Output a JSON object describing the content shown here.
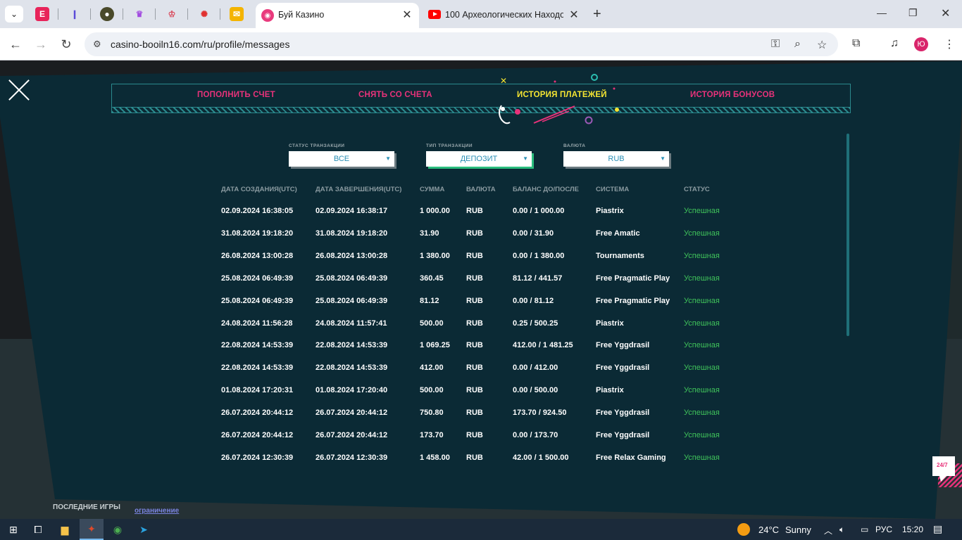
{
  "browser": {
    "tabs": [
      {
        "title": "Буй Казино",
        "active": true
      },
      {
        "title": "100 Археологических Находок",
        "active": false
      }
    ],
    "url": "casino-booiln16.com/ru/profile/messages",
    "profile_initial": "Ю"
  },
  "nav_tabs": {
    "deposit": "ПОПОЛНИТЬ СЧЕТ",
    "withdraw": "СНЯТЬ СО СЧЕТА",
    "payment_history": "ИСТОРИЯ ПЛАТЕЖЕЙ",
    "bonus_history": "ИСТОРИЯ БОНУСОВ"
  },
  "colors": {
    "tab_inactive": "#e8327a",
    "tab_active": "#f5e532",
    "status_success": "#3fc25a",
    "modal_bg": "#0b2a35"
  },
  "filters": {
    "status": {
      "label": "СТАТУС ТРАНЗАКЦИИ",
      "value": "ВСЕ"
    },
    "type": {
      "label": "ТИП ТРАНЗАКЦИИ",
      "value": "ДЕПОЗИТ"
    },
    "currency": {
      "label": "ВАЛЮТА",
      "value": "RUB"
    }
  },
  "table": {
    "headers": [
      "ДАТА СОЗДАНИЯ(UTC)",
      "ДАТА ЗАВЕРШЕНИЯ(UTC)",
      "СУММА",
      "ВАЛЮТА",
      "БАЛАНС ДО/ПОСЛЕ",
      "СИСТЕМА",
      "СТАТУС"
    ],
    "rows": [
      [
        "02.09.2024 16:38:05",
        "02.09.2024 16:38:17",
        "1 000.00",
        "RUB",
        "0.00 / 1 000.00",
        "Piastrix",
        "Успешная"
      ],
      [
        "31.08.2024 19:18:20",
        "31.08.2024 19:18:20",
        "31.90",
        "RUB",
        "0.00 / 31.90",
        "Free Amatic",
        "Успешная"
      ],
      [
        "26.08.2024 13:00:28",
        "26.08.2024 13:00:28",
        "1 380.00",
        "RUB",
        "0.00 / 1 380.00",
        "Tournaments",
        "Успешная"
      ],
      [
        "25.08.2024 06:49:39",
        "25.08.2024 06:49:39",
        "360.45",
        "RUB",
        "81.12 / 441.57",
        "Free Pragmatic Play",
        "Успешная"
      ],
      [
        "25.08.2024 06:49:39",
        "25.08.2024 06:49:39",
        "81.12",
        "RUB",
        "0.00 / 81.12",
        "Free Pragmatic Play",
        "Успешная"
      ],
      [
        "24.08.2024 11:56:28",
        "24.08.2024 11:57:41",
        "500.00",
        "RUB",
        "0.25 / 500.25",
        "Piastrix",
        "Успешная"
      ],
      [
        "22.08.2024 14:53:39",
        "22.08.2024 14:53:39",
        "1 069.25",
        "RUB",
        "412.00 / 1 481.25",
        "Free Yggdrasil",
        "Успешная"
      ],
      [
        "22.08.2024 14:53:39",
        "22.08.2024 14:53:39",
        "412.00",
        "RUB",
        "0.00 / 412.00",
        "Free Yggdrasil",
        "Успешная"
      ],
      [
        "01.08.2024 17:20:31",
        "01.08.2024 17:20:40",
        "500.00",
        "RUB",
        "0.00 / 500.00",
        "Piastrix",
        "Успешная"
      ],
      [
        "26.07.2024 20:44:12",
        "26.07.2024 20:44:12",
        "750.80",
        "RUB",
        "173.70 / 924.50",
        "Free Yggdrasil",
        "Успешная"
      ],
      [
        "26.07.2024 20:44:12",
        "26.07.2024 20:44:12",
        "173.70",
        "RUB",
        "0.00 / 173.70",
        "Free Yggdrasil",
        "Успешная"
      ],
      [
        "26.07.2024 12:30:39",
        "26.07.2024 12:30:39",
        "1 458.00",
        "RUB",
        "42.00 / 1 500.00",
        "Free Relax Gaming",
        "Успешная"
      ]
    ]
  },
  "page_below": {
    "recent_games": "ПОСЛЕДНИЕ ИГРЫ",
    "limit_link": "ограничение"
  },
  "support_badge": "24/7",
  "taskbar": {
    "weather_temp": "24°C",
    "weather_text": "Sunny",
    "language": "РУС",
    "time": "15:20"
  }
}
